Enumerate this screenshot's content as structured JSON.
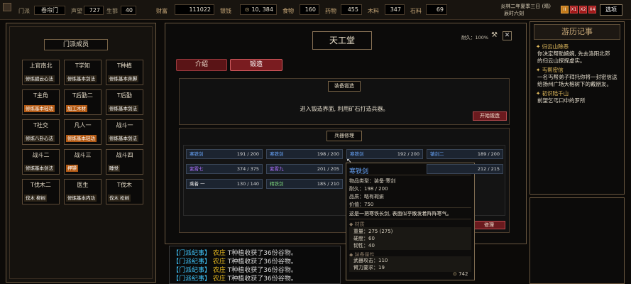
{
  "topbar": {
    "sect_label": "门派",
    "sect_value": "卷帘门",
    "fame_label": "声望",
    "fame_value": "727",
    "floor_label": "生蔀",
    "floor_value": "40",
    "wealth_label": "财富",
    "wealth_value": "111022",
    "silver_label": "银钱",
    "silver_value": "10, 384",
    "food_label": "食物",
    "food_value": "160",
    "herb_label": "药物",
    "herb_value": "455",
    "wood_label": "木料",
    "wood_value": "347",
    "stone_label": "石料",
    "stone_value": "69",
    "date_line1": "炎林二年夏季三日 (晴)",
    "date_line2": "辰时六刻",
    "speed_buttons": [
      "II",
      "X1",
      "X2",
      "X4"
    ],
    "options_label": "选项"
  },
  "members": {
    "title": "门派成员",
    "cards": [
      {
        "name": "上官南北",
        "tag": "修炼碧云心法",
        "tag_style": "dark"
      },
      {
        "name": "T学知",
        "tag": "修炼基本剑法",
        "tag_style": "dark"
      },
      {
        "name": "T种植",
        "tag": "修炼基本奔脚",
        "tag_style": "dark"
      },
      {
        "name": "T主角",
        "tag": "修炼基本轻功",
        "tag_style": "orange"
      },
      {
        "name": "T后勤二",
        "tag": "加工木材",
        "tag_style": "orange"
      },
      {
        "name": "T后勤",
        "tag": "修炼基本剑法",
        "tag_style": "dark"
      },
      {
        "name": "T社交",
        "tag": "修炼八卦心法",
        "tag_style": "dark"
      },
      {
        "name": "凡人一",
        "tag": "修炼基本轻功",
        "tag_style": "orange"
      },
      {
        "name": "战斗一",
        "tag": "修炼基本剑法",
        "tag_style": "dark"
      },
      {
        "name": "战斗二",
        "tag": "修炼基本剑法",
        "tag_style": "dark"
      },
      {
        "name": "战斗三",
        "tag": "押镖",
        "tag_style": "orange"
      },
      {
        "name": "战斗四",
        "tag": "睡觉",
        "tag_style": "dark"
      },
      {
        "name": "T伐木二",
        "tag": "伐木 柳树",
        "tag_style": "dark"
      },
      {
        "name": "医生",
        "tag": "修炼基本内功",
        "tag_style": "dark"
      },
      {
        "name": "T伐木",
        "tag": "伐木 松树",
        "tag_style": "dark"
      }
    ]
  },
  "building": {
    "title": "天工堂",
    "durability": "耐久：100%",
    "tabs": [
      "介绍",
      "锻造"
    ],
    "forge_section_title": "装备锻造",
    "forge_hint": "进入锻造界面, 利用矿石打造兵器。",
    "forge_button": "开始锻造",
    "repair_section_title": "兵器修理",
    "repair_button": "修理",
    "weapons": [
      {
        "name": "寒铁剑",
        "value": "191 / 200",
        "color": "c-blue"
      },
      {
        "name": "寒铁剑",
        "value": "198 / 200",
        "color": "c-blue"
      },
      {
        "name": "寒铁剑",
        "value": "192 / 200",
        "color": "c-blue"
      },
      {
        "name": "镇剑二",
        "value": "189 / 200",
        "color": "c-blue"
      },
      {
        "name": "紫霄七",
        "value": "374 / 375",
        "color": "c-purple"
      },
      {
        "name": "紫霄九",
        "value": "201 / 205",
        "color": "c-purple"
      },
      {
        "name": "",
        "value": "",
        "color": "c-white"
      },
      {
        "name": "",
        "value": "212 / 215",
        "color": "c-white"
      },
      {
        "name": "乘着 一",
        "value": "130 / 140",
        "color": "c-white"
      },
      {
        "name": "精铁剑",
        "value": "185 / 210",
        "color": "c-green"
      }
    ]
  },
  "tooltip": {
    "name": "寒铁剑",
    "type_line": "物品类型：装备·寒剑",
    "dur_line": "耐久：198 / 200",
    "quality_line": "品质：略有瑕疵",
    "price_line": "价值：750",
    "desc": "这是一把寒铁长剑, 表面似乎散发着阵阵寒气。",
    "material_title": "材质",
    "weight_line": "重量：275 (275)",
    "hard_line": "硬度：60",
    "tough_line": "韧性：40",
    "attr_title": "装备属性",
    "atk_line": "武器攻击：110",
    "req_line": "臂力要求：19",
    "coin": "742"
  },
  "log": [
    {
      "a": "【门派纪事】",
      "b": "农庄",
      "c": "T种植收获了36份谷物。"
    },
    {
      "a": "【门派纪事】",
      "b": "农庄",
      "c": "T种植收获了36份谷物。"
    },
    {
      "a": "【门派纪事】",
      "b": "农庄",
      "c": "T种植收获了36份谷物。"
    },
    {
      "a": "【门派纪事】",
      "b": "农庄",
      "c": "T种植收获了36份谷物。"
    }
  ],
  "journal": {
    "title": "游历记事",
    "entries": [
      {
        "head": "归云山除恶",
        "body": [
          "你决定帮助婉婉, 先去洛阳北郊",
          "的归云山探探虚实。"
        ]
      },
      {
        "head": "丐帮密信",
        "body": [
          "一名丐帮弟子拜托你将一封密信送",
          "给扬州广场大榕树下的戴朋友。"
        ]
      },
      {
        "head": "初识陆千山",
        "body": [
          "前望乞丐口中的罗所"
        ]
      }
    ]
  },
  "colors": {
    "accent": "#b84a4e",
    "highlight": "#e8c060",
    "cyan": "#41c8ff"
  }
}
